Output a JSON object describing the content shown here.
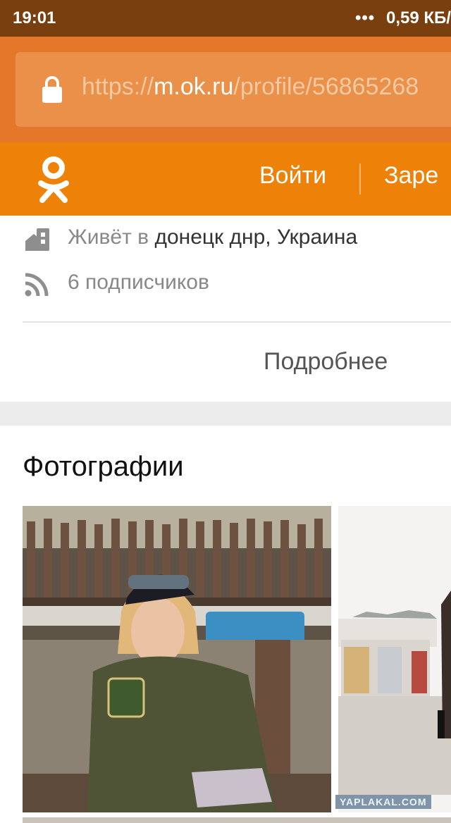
{
  "status_bar": {
    "time": "19:01",
    "dots": "•••",
    "speed": "0,59 КБ/"
  },
  "browser": {
    "url_scheme": "https://",
    "url_host": "m.ok.ru",
    "url_path": "/profile/56865268"
  },
  "header": {
    "logo_icon": "ok-logo-icon",
    "login_label": "Войти",
    "register_label": "Заре"
  },
  "profile_info": {
    "lives_label": "Живёт в ",
    "lives_value": "донецк днр, Украина",
    "subscribers": "6 подписчиков",
    "more_link": "Подробнее"
  },
  "photos": {
    "title": "Фотографии"
  },
  "watermark": "YAPLAKAL.COM",
  "colors": {
    "status_bar": "#7a3f0f",
    "browser_bar": "#e5772a",
    "ok_orange": "#ee8208",
    "section_gap": "#ececec"
  }
}
